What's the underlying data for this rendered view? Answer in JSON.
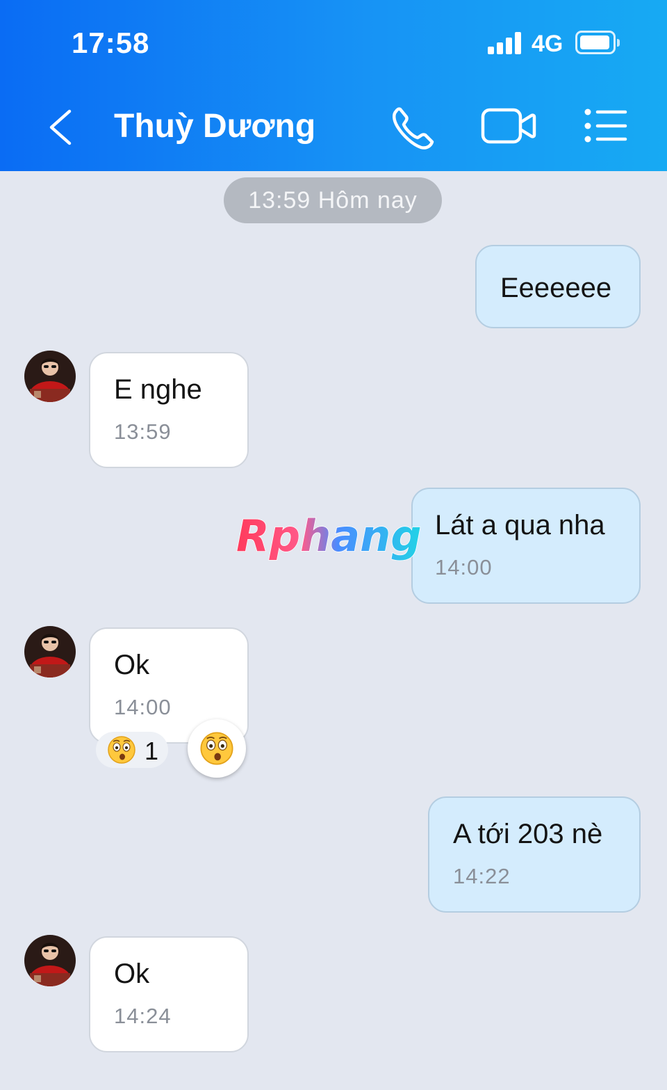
{
  "status_bar": {
    "time": "17:58",
    "network": "4G",
    "signal_icon": "signal-bars-icon",
    "battery_icon": "battery-icon"
  },
  "header": {
    "back_icon": "chevron-left-icon",
    "contact_name": "Thuỳ Dương",
    "call_icon": "phone-icon",
    "video_icon": "video-camera-icon",
    "menu_icon": "list-menu-icon",
    "colors": {
      "gradient_start": "#0a6cf4",
      "gradient_end": "#17aaf3"
    }
  },
  "chat": {
    "date_separator": "13:59 Hôm nay",
    "messages": [
      {
        "direction": "outgoing",
        "text": "Eeeeeee",
        "time": ""
      },
      {
        "direction": "incoming",
        "text": "E nghe",
        "time": "13:59"
      },
      {
        "direction": "outgoing",
        "text": "Lát a qua nha",
        "time": "14:00"
      },
      {
        "direction": "incoming",
        "text": "Ok",
        "time": "14:00",
        "reaction": {
          "emoji_icon": "astonished-face-icon",
          "count": "1"
        }
      },
      {
        "direction": "outgoing",
        "text": "A tới 203 nè",
        "time": "14:22"
      },
      {
        "direction": "incoming",
        "text": "Ok",
        "time": "14:24"
      }
    ],
    "react_button_icon": "astonished-face-icon",
    "colors": {
      "incoming_bubble": "#ffffff",
      "outgoing_bubble": "#d4ecfd",
      "background": "#e3e7f0"
    }
  },
  "watermark": {
    "text": "Rphang"
  }
}
